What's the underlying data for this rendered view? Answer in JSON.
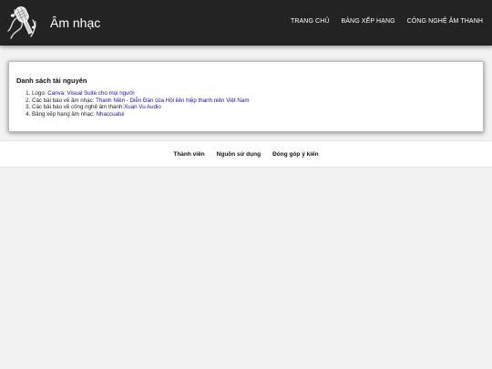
{
  "header": {
    "logo_icon": "microphone-music-icon",
    "title": "Âm nhạc",
    "nav": [
      {
        "label": "TRANG CHỦ"
      },
      {
        "label": "BẢNG XẾP HẠNG"
      },
      {
        "label": "CÔNG NGHỆ ÂM THANH"
      }
    ]
  },
  "resources": {
    "title": "Danh sách tài nguyên",
    "items": [
      {
        "prefix": "Logo: ",
        "link": "Canva: Visual Suite cho mọi người"
      },
      {
        "prefix": "Các bài báo về âm nhạc: ",
        "link": "Thanh Niên - Diễn Đàn của Hội liên hiệp thanh niên Việt Nam"
      },
      {
        "prefix": "Các bài báo về công nghệ âm thanh:",
        "link": "Xuan Vu Audio"
      },
      {
        "prefix": "Bảng xếp hạng âm nhạc: ",
        "link": "Nhaccuatui"
      }
    ]
  },
  "footer": {
    "links": [
      {
        "label": "Thành viên"
      },
      {
        "label": "Nguồn sử dụng"
      },
      {
        "label": "Đóng góp ý kiến"
      }
    ]
  }
}
